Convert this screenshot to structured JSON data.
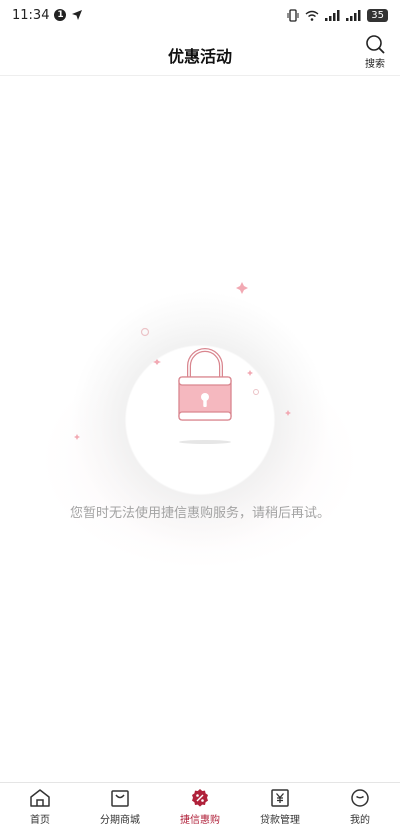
{
  "status_bar": {
    "time": "11:34",
    "notification_badge": "1",
    "battery": "35"
  },
  "header": {
    "title": "优惠活动",
    "search_label": "搜索"
  },
  "empty_state": {
    "message": "您暂时无法使用捷信惠购服务，请稍后再试。"
  },
  "tabs": [
    {
      "label": "首页",
      "icon": "home-icon",
      "active": false
    },
    {
      "label": "分期商城",
      "icon": "shopping-bag-icon",
      "active": false
    },
    {
      "label": "捷信惠购",
      "icon": "discount-badge-icon",
      "active": true
    },
    {
      "label": "贷款管理",
      "icon": "yuan-icon",
      "active": false
    },
    {
      "label": "我的",
      "icon": "profile-icon",
      "active": false
    }
  ],
  "colors": {
    "accent": "#b0213a",
    "lock_fill": "#f5b8bf",
    "lock_stroke": "#d9868f"
  }
}
